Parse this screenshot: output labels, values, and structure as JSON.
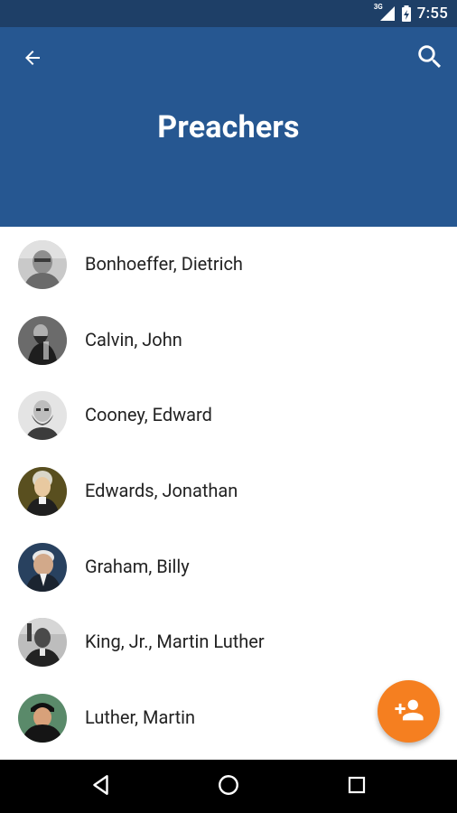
{
  "status_bar": {
    "network_label": "3G",
    "time": "7:55"
  },
  "app_bar": {
    "title": "Preachers",
    "back_icon": "arrow-back-icon",
    "search_icon": "search-icon"
  },
  "preachers": [
    {
      "name": "Bonhoeffer, Dietrich"
    },
    {
      "name": "Calvin, John"
    },
    {
      "name": "Cooney, Edward"
    },
    {
      "name": "Edwards, Jonathan"
    },
    {
      "name": "Graham, Billy"
    },
    {
      "name": "King, Jr., Martin Luther"
    },
    {
      "name": "Luther, Martin"
    }
  ],
  "fab": {
    "icon": "person-add-icon"
  },
  "colors": {
    "status_bar": "#1e3f67",
    "app_bar": "#265791",
    "fab": "#f57f20",
    "nav_bar": "#000000"
  }
}
